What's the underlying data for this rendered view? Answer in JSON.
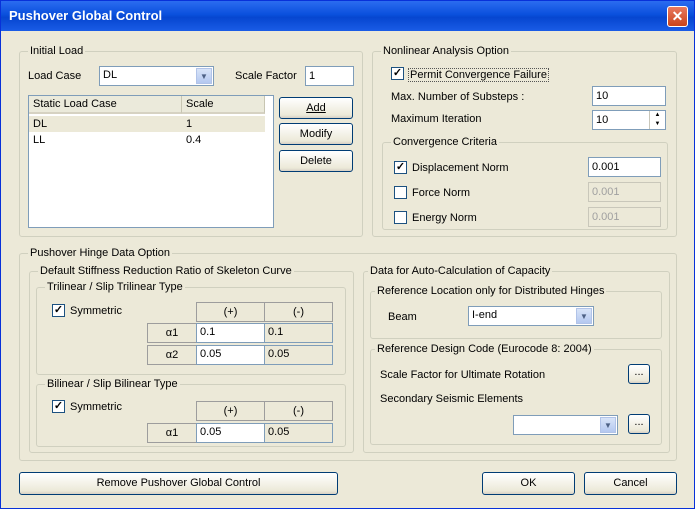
{
  "window": {
    "title": "Pushover Global Control",
    "close": "✕"
  },
  "initial_load": {
    "legend": "Initial Load",
    "load_case_label": "Load Case",
    "load_case_value": "DL",
    "scale_factor_label": "Scale Factor",
    "scale_factor_value": "1",
    "table_headers": [
      "Static Load Case",
      "Scale"
    ],
    "rows": [
      {
        "case": "DL",
        "scale": "1"
      },
      {
        "case": "LL",
        "scale": "0.4"
      }
    ],
    "add": "Add",
    "modify": "Modify",
    "delete": "Delete"
  },
  "nonlinear": {
    "legend": "Nonlinear Analysis Option",
    "permit_label": "Permit Convergence Failure",
    "permit_checked": "✓",
    "substeps_label": "Max. Number of Substeps :",
    "substeps_value": "10",
    "iteration_label": "Maximum Iteration",
    "iteration_value": "10",
    "criteria_legend": "Convergence Criteria",
    "disp_label": "Displacement Norm",
    "disp_checked": "✓",
    "disp_value": "0.001",
    "force_label": "Force Norm",
    "force_value": "0.001",
    "energy_label": "Energy Norm",
    "energy_value": "0.001"
  },
  "hinge": {
    "legend": "Pushover Hinge Data Option",
    "stiffness_legend": "Default Stiffness Reduction Ratio of Skeleton Curve",
    "trilinear": {
      "legend": "Trilinear / Slip Trilinear Type",
      "symmetric_label": "Symmetric",
      "symmetric_checked": "✓",
      "plus": "(+)",
      "minus": "(-)",
      "rows": [
        {
          "label": "α1",
          "plus": "0.1",
          "minus": "0.1"
        },
        {
          "label": "α2",
          "plus": "0.05",
          "minus": "0.05"
        }
      ]
    },
    "bilinear": {
      "legend": "Bilinear / Slip Bilinear Type",
      "symmetric_label": "Symmetric",
      "symmetric_checked": "✓",
      "plus": "(+)",
      "minus": "(-)",
      "rows": [
        {
          "label": "α1",
          "plus": "0.05",
          "minus": "0.05"
        }
      ]
    },
    "capacity": {
      "legend": "Data for Auto-Calculation of Capacity",
      "ref_loc_legend": "Reference Location only for Distributed Hinges",
      "beam_label": "Beam",
      "beam_value": "I-end",
      "design_code_legend": "Reference Design Code (Eurocode 8: 2004)",
      "scale_factor_label": "Scale Factor for Ultimate Rotation",
      "secondary_label": "Secondary Seismic Elements",
      "ellipsis": "..."
    }
  },
  "footer": {
    "remove": "Remove Pushover Global Control",
    "ok": "OK",
    "cancel": "Cancel"
  },
  "icons": {
    "dropdown": "▼",
    "spin_up": "▲",
    "spin_down": "▼"
  }
}
